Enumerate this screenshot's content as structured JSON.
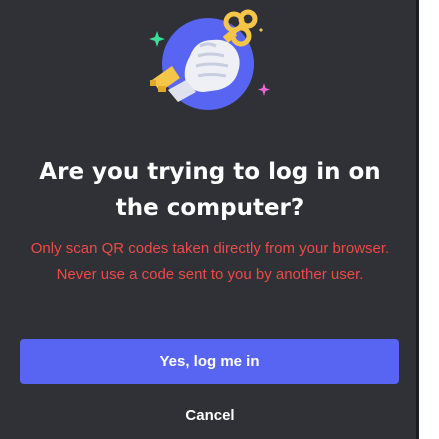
{
  "dialog": {
    "illustration_icon": "hand-holding-key-icon",
    "title": "Are you trying to log in on the computer?",
    "warning": "Only scan QR codes taken directly from your browser. Never use a code sent to you by another user.",
    "confirm_label": "Yes, log me in",
    "cancel_label": "Cancel"
  },
  "colors": {
    "background": "#2f3137",
    "title": "#ffffff",
    "warning": "#ee4a46",
    "primary": "#5865f2",
    "illustration_circle": "#5865f2",
    "key": "#f5c54a",
    "sparkle_green": "#3ddc97",
    "sparkle_yellow": "#f5c54a",
    "sparkle_pink": "#eb66d6"
  }
}
